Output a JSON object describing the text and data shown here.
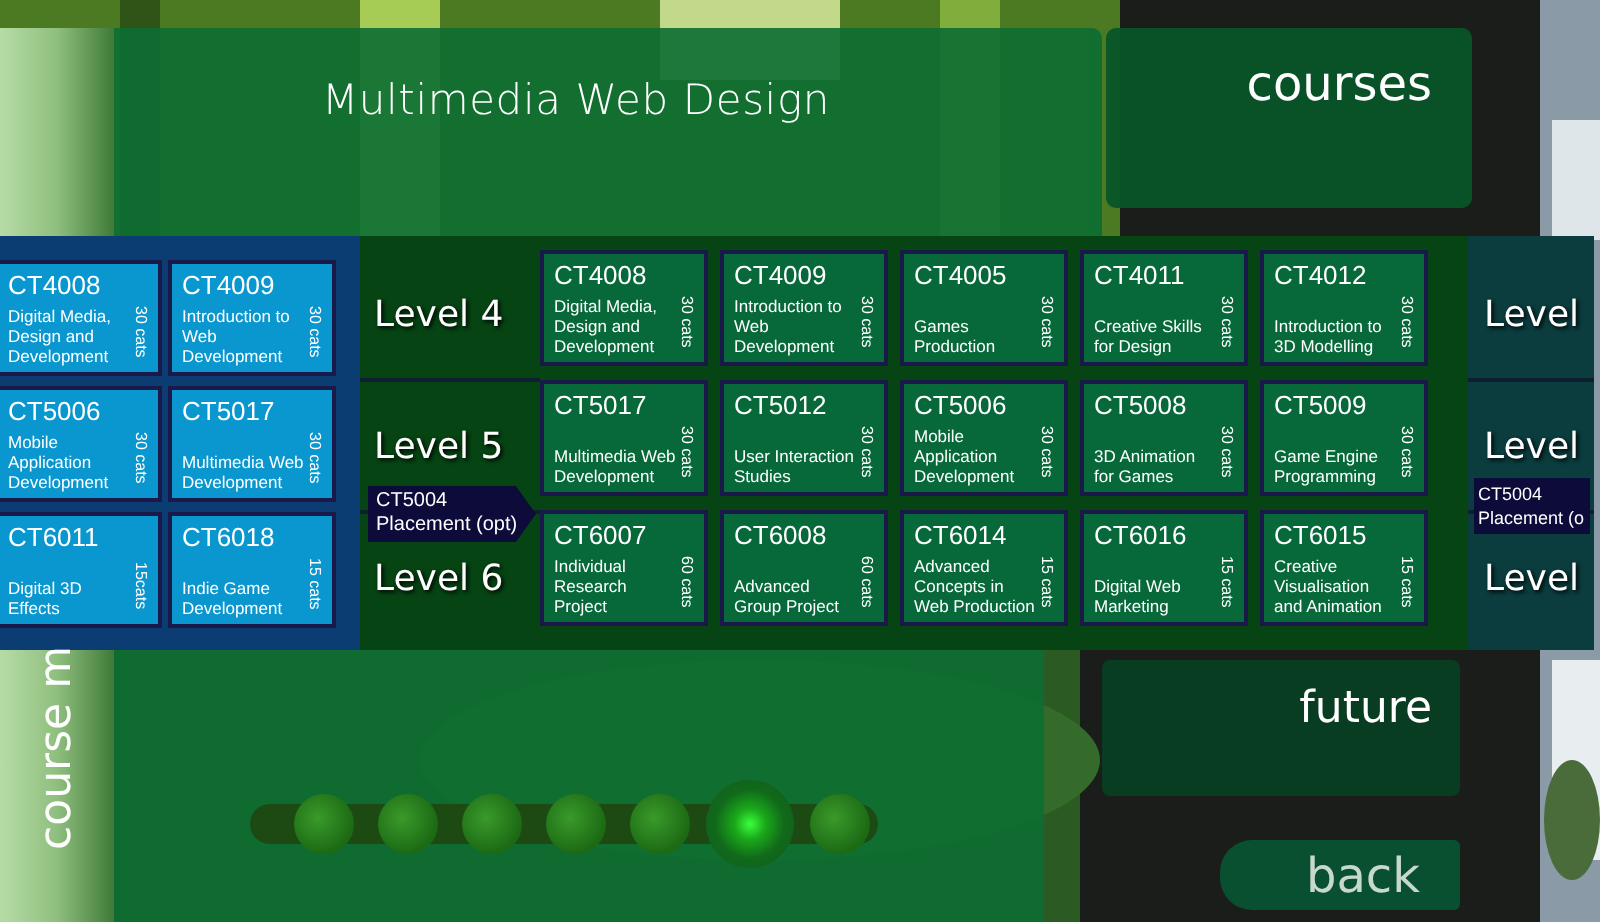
{
  "title": "Multimedia Web Design",
  "nav": {
    "courses": "courses",
    "future": "future",
    "back": "back"
  },
  "side_tab": "course m",
  "previous_course": [
    [
      {
        "code": "CT4008",
        "title": "Digital Media, Design and Development",
        "credits": "30 cats"
      },
      {
        "code": "CT4009",
        "title": "Introduction to Web Development",
        "credits": "30 cats"
      }
    ],
    [
      {
        "code": "CT5006",
        "title": "Mobile Application Development",
        "credits": "30 cats"
      },
      {
        "code": "CT5017",
        "title": "Multimedia Web Development",
        "credits": "30 cats"
      }
    ],
    [
      {
        "code": "CT6011",
        "title": "Digital 3D Effects",
        "credits": "15cats"
      },
      {
        "code": "CT6018",
        "title": "Indie Game Development",
        "credits": "15 cats"
      }
    ]
  ],
  "levels": [
    "Level 4",
    "Level 5",
    "Level 6"
  ],
  "placement": {
    "code": "CT5004",
    "label": "Placement (opt)"
  },
  "modules": [
    [
      {
        "code": "CT4008",
        "title": "Digital Media, Design and Development",
        "credits": "30 cats"
      },
      {
        "code": "CT4009",
        "title": "Introduction to Web Development",
        "credits": "30 cats"
      },
      {
        "code": "CT4005",
        "title": "Games Production",
        "credits": "30 cats"
      },
      {
        "code": "CT4011",
        "title": "Creative Skills for Design",
        "credits": "30 cats"
      },
      {
        "code": "CT4012",
        "title": "Introduction to 3D Modelling",
        "credits": "30 cats"
      }
    ],
    [
      {
        "code": "CT5017",
        "title": "Multimedia Web Development",
        "credits": "30 cats"
      },
      {
        "code": "CT5012",
        "title": "User Interaction Studies",
        "credits": "30 cats"
      },
      {
        "code": "CT5006",
        "title": "Mobile Application Development",
        "credits": "30 cats"
      },
      {
        "code": "CT5008",
        "title": "3D Animation for Games",
        "credits": "30 cats"
      },
      {
        "code": "CT5009",
        "title": "Game Engine Programming",
        "credits": "30 cats"
      }
    ],
    [
      {
        "code": "CT6007",
        "title": "Individual Research Project",
        "credits": "60 cats"
      },
      {
        "code": "CT6008",
        "title": "Advanced Group Project",
        "credits": "60 cats"
      },
      {
        "code": "CT6014",
        "title": "Advanced Concepts in Web Production",
        "credits": "15 cats"
      },
      {
        "code": "CT6016",
        "title": "Digital Web Marketing",
        "credits": "15 cats"
      },
      {
        "code": "CT6015",
        "title": "Creative Visualisation and Animation",
        "credits": "15 cats"
      }
    ]
  ],
  "next_course": {
    "levels": [
      "Level",
      "Level",
      "Level"
    ],
    "placement": {
      "code": "CT5004",
      "label": "Placement (o"
    }
  },
  "slider": {
    "stops": [
      {
        "selected": false
      },
      {
        "selected": false
      },
      {
        "selected": false
      },
      {
        "selected": false
      },
      {
        "selected": false
      },
      {
        "selected": true
      },
      {
        "selected": false
      }
    ]
  }
}
